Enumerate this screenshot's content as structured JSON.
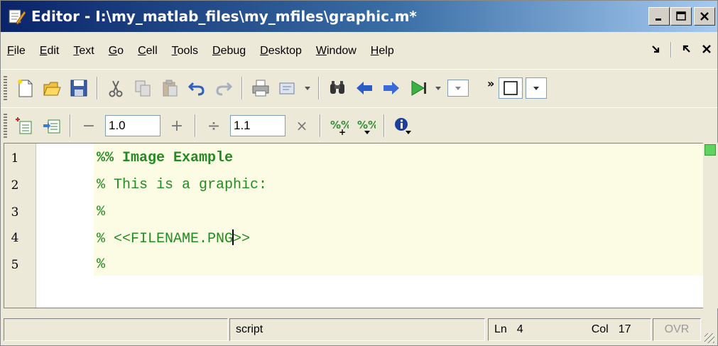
{
  "window": {
    "title": "Editor - I:\\my_matlab_files\\my_mfiles\\graphic.m*"
  },
  "menubar": {
    "items": [
      "File",
      "Edit",
      "Text",
      "Go",
      "Cell",
      "Tools",
      "Debug",
      "Desktop",
      "Window",
      "Help"
    ]
  },
  "toolbar1": {
    "buttons": [
      "new-file-icon",
      "open-folder-icon",
      "save-icon",
      "cut-icon",
      "copy-icon",
      "paste-icon",
      "undo-icon",
      "redo-icon",
      "print-icon",
      "comment-icon",
      "find-binoculars-icon",
      "back-arrow-icon",
      "forward-arrow-icon",
      "run-icon"
    ]
  },
  "toolbar2": {
    "minus_label": "−",
    "plus_label": "+",
    "divide_label": "÷",
    "times_label": "×",
    "decrement_value": "1.0",
    "multiply_value": "1.1"
  },
  "editor": {
    "lines": [
      {
        "number": "1",
        "text": "%% Image Example"
      },
      {
        "number": "2",
        "text": "% This is a graphic:"
      },
      {
        "number": "3",
        "text": "%"
      },
      {
        "number": "4",
        "text_before_caret": "% <<FILENAME.PNG",
        "text_after_caret": ">>"
      },
      {
        "number": "5",
        "text": "%"
      }
    ],
    "colors": {
      "comment": "#228b22",
      "cell_band": "#fcfbe3"
    }
  },
  "statusbar": {
    "file_type": "script",
    "ln_label": "Ln",
    "ln_value": "4",
    "col_label": "Col",
    "col_value": "17",
    "ovr_label": "OVR"
  }
}
